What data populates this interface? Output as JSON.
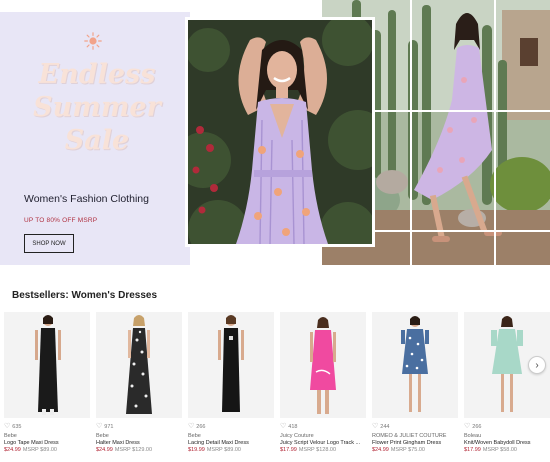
{
  "hero": {
    "title_lines": [
      "Endless",
      "Summer",
      "Sale"
    ],
    "subtitle": "Women's Fashion Clothing",
    "promo": "UP TO 80% OFF MSRP",
    "cta": "SHOP NOW",
    "colors": {
      "panel": "#e8e6f6",
      "title": "#f8e2d8",
      "promo": "#b03040",
      "sun": "#f2a38a"
    }
  },
  "bestsellers": {
    "title": "Bestsellers: Women's Dresses",
    "next_icon": "chevron-right-icon",
    "products": [
      {
        "likes": "635",
        "brand": "Bebe",
        "name": "Logo Tape Maxi Dress",
        "price": "$24.99",
        "msrp": "MSRP $89.00",
        "dress_color": "#1a1a1a",
        "style": "maxi-tank"
      },
      {
        "likes": "971",
        "brand": "Bebe",
        "name": "Halter Maxi Dress",
        "price": "$24.99",
        "msrp": "MSRP $129.00",
        "dress_color": "#2a2a2a",
        "style": "maxi-print"
      },
      {
        "likes": "266",
        "brand": "Bebe",
        "name": "Lacing Detail Maxi Dress",
        "price": "$19.99",
        "msrp": "MSRP $89.00",
        "dress_color": "#151515",
        "style": "maxi-tank"
      },
      {
        "likes": "418",
        "brand": "Juicy Couture",
        "name": "Juicy Script Velour Logo Track ...",
        "price": "$17.99",
        "msrp": "MSRP $128.00",
        "dress_color": "#f04aa0",
        "style": "mini"
      },
      {
        "likes": "244",
        "brand": "ROMEO & JULIET COUTURE",
        "name": "Flower Print Gingham Dress",
        "price": "$24.99",
        "msrp": "MSRP $75.00",
        "dress_color": "#4a6fa0",
        "style": "mini-print"
      },
      {
        "likes": "266",
        "brand": "Boleau",
        "name": "Knit/Woven Babydoll Dress",
        "price": "$17.99",
        "msrp": "MSRP $58.00",
        "dress_color": "#a8d8c8",
        "style": "babydoll"
      }
    ]
  }
}
